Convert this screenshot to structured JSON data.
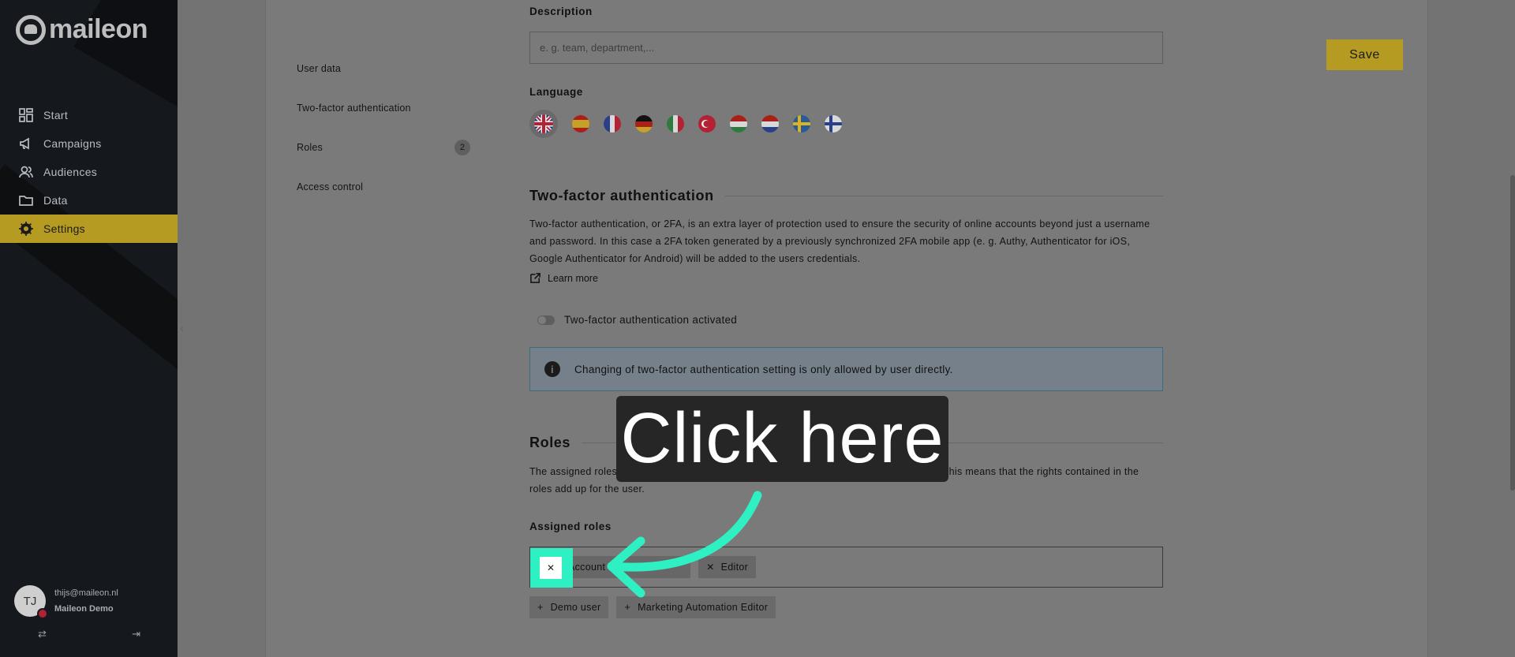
{
  "app": {
    "logo_text": "maileon"
  },
  "sidebar": {
    "items": [
      {
        "label": "Start",
        "icon": "dashboard-icon"
      },
      {
        "label": "Campaigns",
        "icon": "megaphone-icon"
      },
      {
        "label": "Audiences",
        "icon": "users-icon"
      },
      {
        "label": "Data",
        "icon": "folder-icon"
      },
      {
        "label": "Settings",
        "icon": "gear-icon",
        "active": true
      }
    ],
    "user": {
      "initials": "TJ",
      "email": "thijs@maileon.nl",
      "account": "Maileon Demo"
    }
  },
  "subnav": {
    "items": [
      {
        "label": "User data"
      },
      {
        "label": "Two-factor authentication"
      },
      {
        "label": "Roles",
        "count": "2"
      },
      {
        "label": "Access control"
      }
    ]
  },
  "form": {
    "description": {
      "label": "Description",
      "placeholder": "e. g. team, department,..."
    },
    "language": {
      "label": "Language",
      "flags": [
        "gb",
        "es",
        "fr",
        "de",
        "it",
        "tr",
        "hu",
        "nl",
        "se",
        "fi"
      ],
      "selected": "gb"
    },
    "two_factor": {
      "title": "Two-factor authentication",
      "text": "Two-factor authentication, or 2FA, is an extra layer of protection used to ensure the security of online accounts beyond just a username and password. In this case a 2FA token generated by a previously synchronized 2FA mobile app (e. g. Authy, Authenticator for iOS, Google Authenticator for Android) will be added to the users credentials.",
      "learn_more": "Learn more",
      "toggle_label": "Two-factor authentication activated",
      "info": "Changing of two-factor authentication setting is only allowed by user directly."
    },
    "roles": {
      "title": "Roles",
      "text": "The assigned roles limit the user's rights within the system. Roles behave additively here. This means that the rights contained in the roles add up for the user.",
      "assigned_label": "Assigned roles",
      "assigned": [
        "Account",
        "Editor"
      ],
      "available": [
        "Demo user",
        "Marketing Automation Editor"
      ]
    }
  },
  "toolbar": {
    "save_label": "Save"
  },
  "overlay": {
    "callout": "Click here",
    "accent_color": "#2ef0c2"
  }
}
